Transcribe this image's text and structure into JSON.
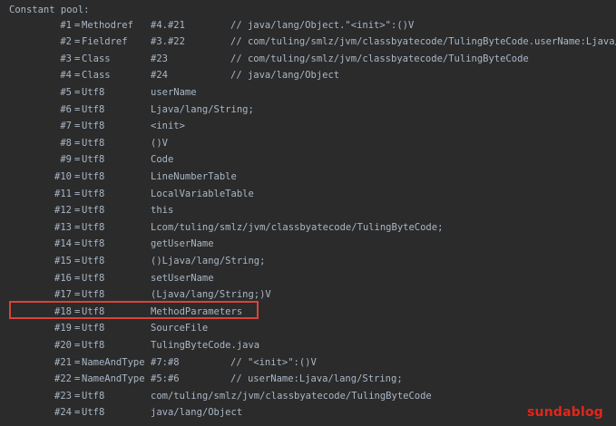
{
  "header": "Constant pool:",
  "rows": [
    {
      "index": "#1",
      "type": "Methodref",
      "value": "#4.#21",
      "comment": "// java/lang/Object.\"<init>\":()V"
    },
    {
      "index": "#2",
      "type": "Fieldref",
      "value": "#3.#22",
      "comment": "// com/tuling/smlz/jvm/classbyatecode/TulingByteCode.userName:Ljava/lang/S"
    },
    {
      "index": "#3",
      "type": "Class",
      "value": "#23",
      "comment": "// com/tuling/smlz/jvm/classbyatecode/TulingByteCode"
    },
    {
      "index": "#4",
      "type": "Class",
      "value": "#24",
      "comment": "// java/lang/Object"
    },
    {
      "index": "#5",
      "type": "Utf8",
      "value": "userName",
      "comment": ""
    },
    {
      "index": "#6",
      "type": "Utf8",
      "value": "Ljava/lang/String;",
      "comment": ""
    },
    {
      "index": "#7",
      "type": "Utf8",
      "value": "<init>",
      "comment": ""
    },
    {
      "index": "#8",
      "type": "Utf8",
      "value": "()V",
      "comment": ""
    },
    {
      "index": "#9",
      "type": "Utf8",
      "value": "Code",
      "comment": ""
    },
    {
      "index": "#10",
      "type": "Utf8",
      "value": "LineNumberTable",
      "comment": ""
    },
    {
      "index": "#11",
      "type": "Utf8",
      "value": "LocalVariableTable",
      "comment": ""
    },
    {
      "index": "#12",
      "type": "Utf8",
      "value": "this",
      "comment": ""
    },
    {
      "index": "#13",
      "type": "Utf8",
      "value": "Lcom/tuling/smlz/jvm/classbyatecode/TulingByteCode;",
      "comment": ""
    },
    {
      "index": "#14",
      "type": "Utf8",
      "value": "getUserName",
      "comment": ""
    },
    {
      "index": "#15",
      "type": "Utf8",
      "value": "()Ljava/lang/String;",
      "comment": ""
    },
    {
      "index": "#16",
      "type": "Utf8",
      "value": "setUserName",
      "comment": ""
    },
    {
      "index": "#17",
      "type": "Utf8",
      "value": "(Ljava/lang/String;)V",
      "comment": ""
    },
    {
      "index": "#18",
      "type": "Utf8",
      "value": "MethodParameters",
      "comment": ""
    },
    {
      "index": "#19",
      "type": "Utf8",
      "value": "SourceFile",
      "comment": ""
    },
    {
      "index": "#20",
      "type": "Utf8",
      "value": "TulingByteCode.java",
      "comment": ""
    },
    {
      "index": "#21",
      "type": "NameAndType",
      "value": "#7:#8",
      "comment": "// \"<init>\":()V"
    },
    {
      "index": "#22",
      "type": "NameAndType",
      "value": "#5:#6",
      "comment": "// userName:Ljava/lang/String;"
    },
    {
      "index": "#23",
      "type": "Utf8",
      "value": "com/tuling/smlz/jvm/classbyatecode/TulingByteCode",
      "comment": ""
    },
    {
      "index": "#24",
      "type": "Utf8",
      "value": "java/lang/Object",
      "comment": ""
    }
  ],
  "watermark": "sundablog",
  "colors": {
    "background": "#2b2b2b",
    "text": "#a9b7c6",
    "highlight_border": "#d9433a",
    "watermark": "#e2261b"
  }
}
